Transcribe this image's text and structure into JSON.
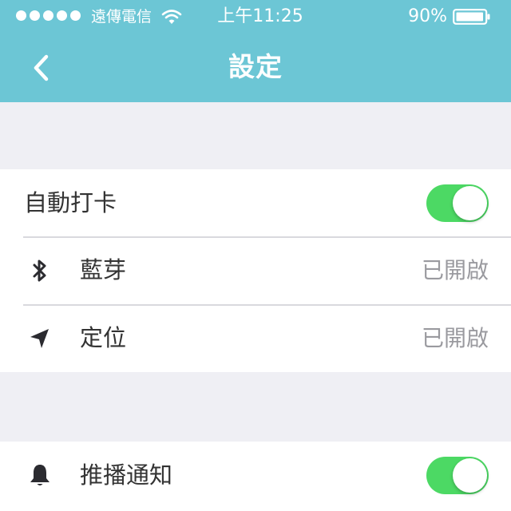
{
  "status_bar": {
    "carrier": "遠傳電信",
    "time": "上午11:25",
    "battery": "90%"
  },
  "nav": {
    "title": "設定",
    "back_icon": "chevron-left-icon"
  },
  "group1": {
    "auto_punch": {
      "label": "自動打卡",
      "enabled": true
    },
    "bluetooth": {
      "icon": "bluetooth-icon",
      "label": "藍芽",
      "value": "已開啟"
    },
    "location": {
      "icon": "location-arrow-icon",
      "label": "定位",
      "value": "已開啟"
    }
  },
  "group2": {
    "push": {
      "icon": "bell-icon",
      "label": "推播通知",
      "enabled": true
    }
  },
  "colors": {
    "header": "#6cc6d5",
    "toggle_on": "#4cd964",
    "background": "#efeff4"
  }
}
